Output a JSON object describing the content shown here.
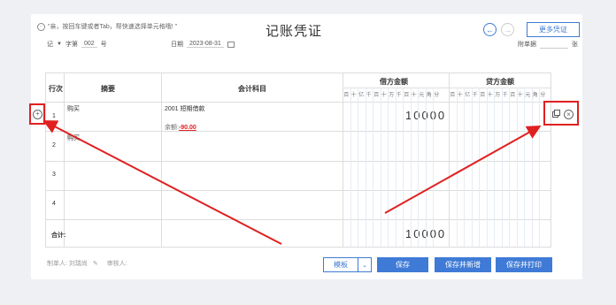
{
  "tip_text": "\"亲，按回车键或者Tab，帮快速选择单元格哦! \"",
  "title": "记账凭证",
  "more_label": "更多凭证",
  "meta": {
    "voucher_word": "记",
    "word_label": "字第",
    "number": "002",
    "number_suffix": "号",
    "date_label": "日期",
    "date": "2023-08-31",
    "attach_label": "附单据",
    "attach_unit": "张"
  },
  "table": {
    "col_row": "行次",
    "col_summary": "摘要",
    "col_account": "会计科目",
    "col_debit": "借方金额",
    "col_credit": "贷方金额",
    "digit_labels": [
      "百",
      "十",
      "亿",
      "千",
      "百",
      "十",
      "万",
      "千",
      "百",
      "十",
      "元",
      "角",
      "分"
    ],
    "rows": [
      {
        "no": "1",
        "summary": "购买",
        "account": "2001 短期借款",
        "balance_label": "余额:",
        "balance_value": "-90.00",
        "debit": "10000"
      },
      {
        "no": "2",
        "summary": "购买"
      },
      {
        "no": "3"
      },
      {
        "no": "4"
      }
    ],
    "total_label": "合计:",
    "total_debit": "10000"
  },
  "footer": {
    "maker_label": "制单人:",
    "maker_name": "刘瑞尚",
    "auditor_label": "审核人:"
  },
  "buttons": {
    "template": "模板",
    "save": "保存",
    "save_new": "保存并新增",
    "save_print": "保存并打印"
  },
  "colors": {
    "accent": "#3f7bd6",
    "highlight": "#e02020"
  }
}
